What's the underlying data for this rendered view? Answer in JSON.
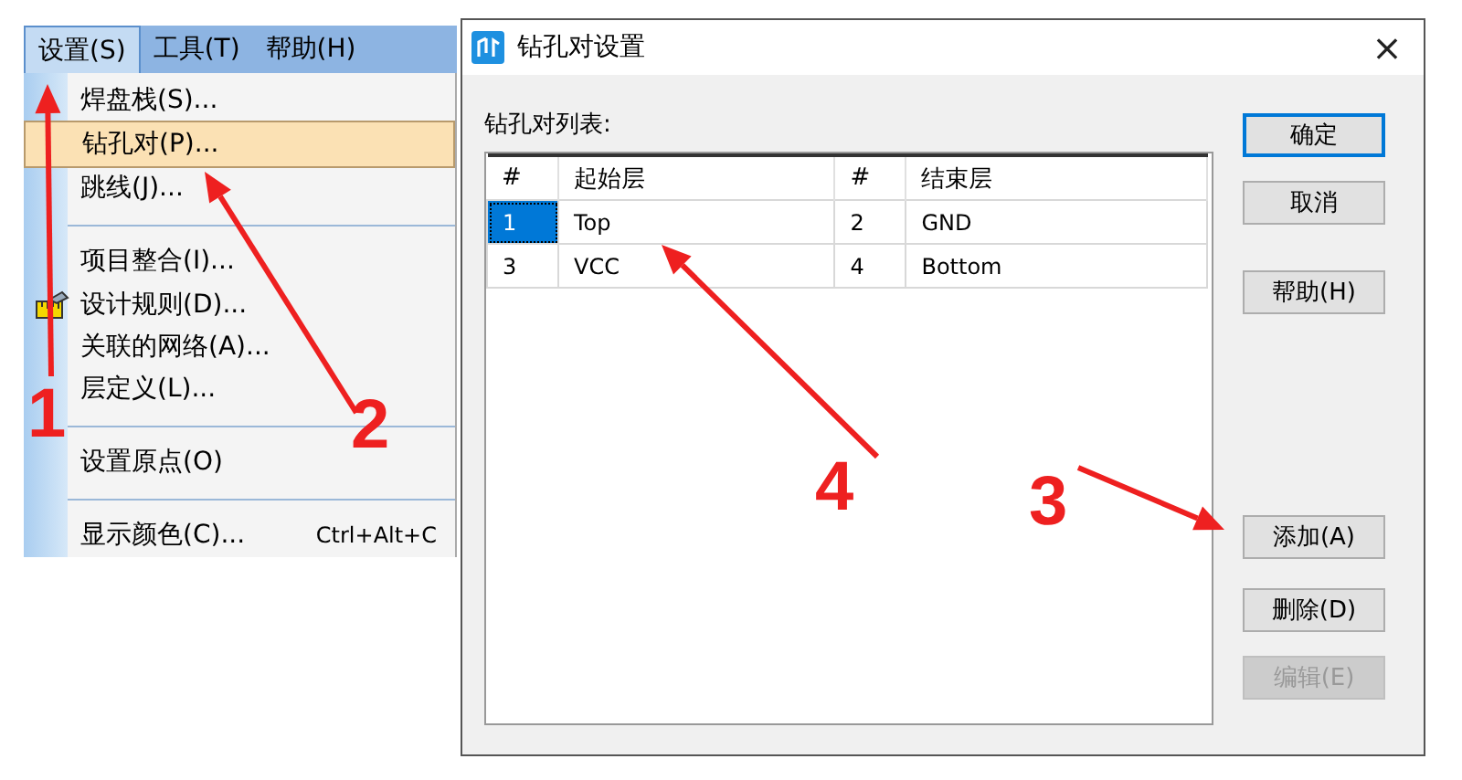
{
  "menubar": [
    {
      "label": "设置(S)",
      "selected": true
    },
    {
      "label": "工具(T)",
      "selected": false
    },
    {
      "label": "帮助(H)",
      "selected": false
    }
  ],
  "menu": {
    "items": [
      {
        "kind": "item",
        "label": "焊盘栈(S)...",
        "selected": false
      },
      {
        "kind": "item",
        "label": "钻孔对(P)...",
        "selected": true
      },
      {
        "kind": "item",
        "label": "跳线(J)...",
        "selected": false
      },
      {
        "kind": "separator"
      },
      {
        "kind": "item",
        "label": "项目整合(I)...",
        "selected": false
      },
      {
        "kind": "item",
        "label": "设计规则(D)...",
        "selected": false,
        "icon": true
      },
      {
        "kind": "item",
        "label": "关联的网络(A)...",
        "selected": false
      },
      {
        "kind": "item",
        "label": "层定义(L)...",
        "selected": false
      },
      {
        "kind": "separator"
      },
      {
        "kind": "item",
        "label": "设置原点(O)",
        "selected": false
      },
      {
        "kind": "separator"
      },
      {
        "kind": "item",
        "label": "显示颜色(C)...",
        "selected": false,
        "shortcut": "Ctrl+Alt+C"
      }
    ]
  },
  "dialog": {
    "title": "钻孔对设置",
    "close": "×",
    "list_label": "钻孔对列表:",
    "table": {
      "columns": [
        "#",
        "起始层",
        "#",
        "结束层"
      ],
      "rows": [
        {
          "cells": [
            "1",
            "Top",
            "2",
            "GND"
          ],
          "selected": true
        },
        {
          "cells": [
            "3",
            "VCC",
            "4",
            "Bottom"
          ],
          "selected": false
        }
      ]
    },
    "buttons": [
      {
        "label": "确定",
        "default": true,
        "disabled": false
      },
      {
        "label": "取消",
        "default": false,
        "disabled": false
      },
      {
        "label": "帮助(H)",
        "default": false,
        "disabled": false
      },
      {
        "label": "添加(A)",
        "default": false,
        "disabled": false
      },
      {
        "label": "删除(D)",
        "default": false,
        "disabled": false
      },
      {
        "label": "编辑(E)",
        "default": false,
        "disabled": true
      }
    ]
  },
  "annotations": [
    {
      "label": "1"
    },
    {
      "label": "2"
    },
    {
      "label": "3"
    },
    {
      "label": "4"
    }
  ]
}
